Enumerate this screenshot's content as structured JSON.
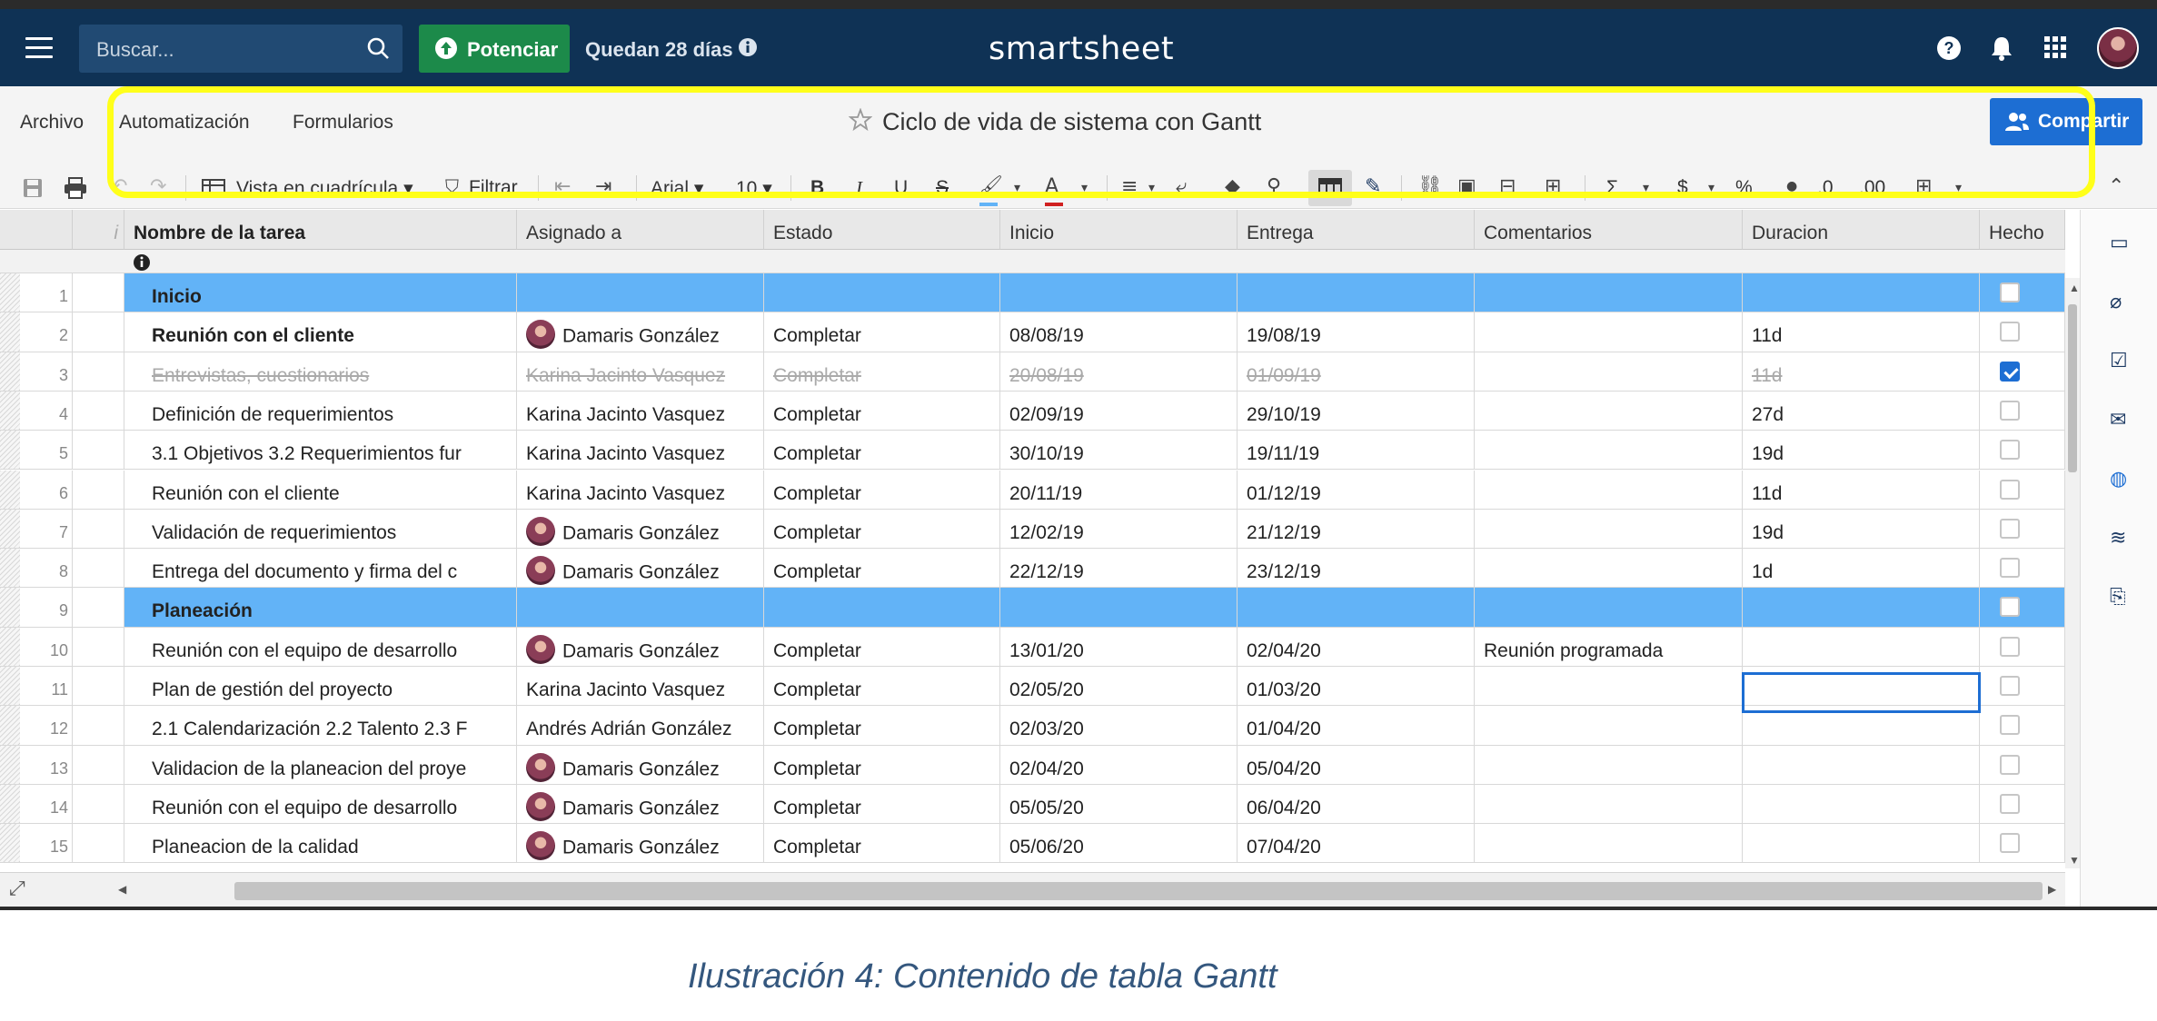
{
  "topnav": {
    "search_placeholder": "Buscar...",
    "upgrade_label": "Potenciar",
    "trial_text": "Quedan 28 días",
    "logo": "smartsheet"
  },
  "menu": {
    "archivo": "Archivo",
    "automatizacion": "Automatización",
    "formularios": "Formularios"
  },
  "sheet_title": "Ciclo de vida de sistema con Gantt",
  "share_label": "Compartir",
  "toolbar": {
    "view_label": "Vista en cuadrícula",
    "filter_label": "Filtrar",
    "font_label": "Arial",
    "size_label": "10",
    "bold": "B",
    "italic": "I",
    "underline": "U",
    "strike": "S",
    "sum": "Σ",
    "currency": "$",
    "percent": "%",
    "dec_dec": ".0",
    "dec_inc": ".00"
  },
  "columns": [
    "Nombre de la tarea",
    "Asignado a",
    "Estado",
    "Inicio",
    "Entrega",
    "Comentarios",
    "Duracion",
    "Hecho"
  ],
  "rows": [
    {
      "num": "1",
      "name": "Inicio",
      "assignee": "",
      "status": "",
      "start": "",
      "end": "",
      "comments": "",
      "duration": "",
      "done": false
    },
    {
      "num": "2",
      "name": "Reunión con el cliente",
      "assignee": "Damaris González",
      "status": "Completar",
      "start": "08/08/19",
      "end": "19/08/19",
      "comments": "",
      "duration": "11d",
      "done": false
    },
    {
      "num": "3",
      "name": "Entrevistas, cuestionarios",
      "assignee": "Karina Jacinto Vasquez",
      "status": "Completar",
      "start": "20/08/19",
      "end": "01/09/19",
      "comments": "",
      "duration": "11d",
      "done": true
    },
    {
      "num": "4",
      "name": "Definición de requerimientos",
      "assignee": "Karina Jacinto Vasquez",
      "status": "Completar",
      "start": "02/09/19",
      "end": "29/10/19",
      "comments": "",
      "duration": "27d",
      "done": false
    },
    {
      "num": "5",
      "name": "3.1 Objetivos 3.2 Requerimientos fur",
      "assignee": "Karina Jacinto Vasquez",
      "status": "Completar",
      "start": "30/10/19",
      "end": "19/11/19",
      "comments": "",
      "duration": "19d",
      "done": false
    },
    {
      "num": "6",
      "name": "Reunión con el cliente",
      "assignee": "Karina Jacinto Vasquez",
      "status": "Completar",
      "start": "20/11/19",
      "end": "01/12/19",
      "comments": "",
      "duration": "11d",
      "done": false
    },
    {
      "num": "7",
      "name": "Validación de requerimientos",
      "assignee": "Damaris González",
      "status": "Completar",
      "start": "12/02/19",
      "end": "21/12/19",
      "comments": "",
      "duration": "19d",
      "done": false
    },
    {
      "num": "8",
      "name": "Entrega del documento y firma del c",
      "assignee": "Damaris González",
      "status": "Completar",
      "start": "22/12/19",
      "end": "23/12/19",
      "comments": "",
      "duration": "1d",
      "done": false
    },
    {
      "num": "9",
      "name": "Planeación",
      "assignee": "",
      "status": "",
      "start": "",
      "end": "",
      "comments": "",
      "duration": "",
      "done": false
    },
    {
      "num": "10",
      "name": "Reunión con el equipo de desarrollo",
      "assignee": "Damaris González",
      "status": "Completar",
      "start": "13/01/20",
      "end": "02/04/20",
      "comments": "Reunión programada",
      "duration": "",
      "done": false
    },
    {
      "num": "11",
      "name": "Plan de gestión del proyecto",
      "assignee": "Karina Jacinto Vasquez",
      "status": "Completar",
      "start": "02/05/20",
      "end": "01/03/20",
      "comments": "",
      "duration": "",
      "done": false
    },
    {
      "num": "12",
      "name": "2.1 Calendarización 2.2 Talento 2.3 F",
      "assignee": "Andrés Adrián González",
      "status": "Completar",
      "start": "02/03/20",
      "end": "01/04/20",
      "comments": "",
      "duration": "",
      "done": false
    },
    {
      "num": "13",
      "name": "Validacion de la planeacion del proye",
      "assignee": "Damaris González",
      "status": "Completar",
      "start": "02/04/20",
      "end": "05/04/20",
      "comments": "",
      "duration": "",
      "done": false
    },
    {
      "num": "14",
      "name": "Reunión con el equipo de desarrollo",
      "assignee": "Damaris González",
      "status": "Completar",
      "start": "05/05/20",
      "end": "06/04/20",
      "comments": "",
      "duration": "",
      "done": false
    },
    {
      "num": "15",
      "name": "Planeacion de la calidad",
      "assignee": "Damaris González",
      "status": "Completar",
      "start": "05/06/20",
      "end": "07/04/20",
      "comments": "",
      "duration": "",
      "done": false
    }
  ],
  "caption": "Ilustración 4: Contenido de tabla Gantt",
  "colors": {
    "nav": "#0f3255",
    "parent_row": "#62b3f7",
    "accent": "#1d6ed3",
    "highlight": "#ffff1a",
    "upgrade": "#1c8a4a"
  }
}
